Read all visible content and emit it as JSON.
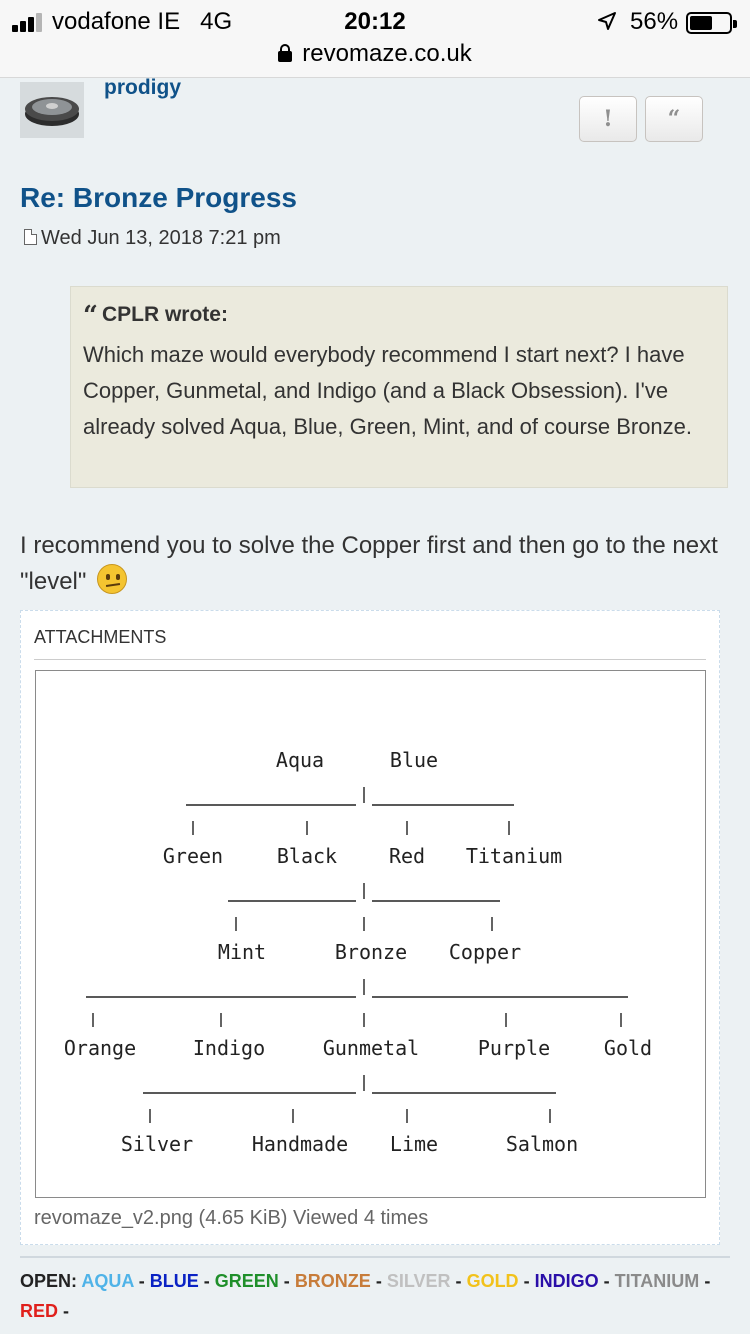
{
  "statusbar": {
    "carrier": "vodafone IE",
    "network": "4G",
    "time": "20:12",
    "battery": "56%",
    "url": "revomaze.co.uk"
  },
  "post": {
    "username": "prodigy",
    "report_icon": "!",
    "quote_icon": "“",
    "title": "Re: Bronze Progress",
    "date": "Wed Jun 13, 2018 7:21 pm",
    "quote": {
      "author": "CPLR wrote:",
      "text": "Which maze would everybody recommend I start next? I have Copper, Gunmetal, and Indigo (and a Black Obsession). I've already solved Aqua, Blue, Green, Mint, and of course Bronze."
    },
    "body": "I recommend you to solve the Copper first and then go to the next \"level\""
  },
  "attachments": {
    "label": "ATTACHMENTS",
    "caption": "revomaze_v2.png (4.65 KiB) Viewed 4 times",
    "tree": {
      "level1": [
        "Aqua",
        "Blue"
      ],
      "level2": [
        "Green",
        "Black",
        "Red",
        "Titanium"
      ],
      "level3": [
        "Mint",
        "Bronze",
        "Copper"
      ],
      "level4": [
        "Orange",
        "Indigo",
        "Gunmetal",
        "Purple",
        "Gold"
      ],
      "level5": [
        "Silver",
        "Handmade",
        "Lime",
        "Salmon"
      ]
    }
  },
  "signature": {
    "prefix": "OPEN:",
    "separator": "-",
    "items": [
      {
        "name": "AQUA",
        "color": "#4fb3e8"
      },
      {
        "name": "BLUE",
        "color": "#0a22c4"
      },
      {
        "name": "GREEN",
        "color": "#1f8f2a"
      },
      {
        "name": "BRONZE",
        "color": "#c77c3a"
      },
      {
        "name": "SILVER",
        "color": "#c0c0c0"
      },
      {
        "name": "GOLD",
        "color": "#f2c21b"
      },
      {
        "name": "INDIGO",
        "color": "#2a0fa8"
      },
      {
        "name": "TITANIUM",
        "color": "#8a8a8a"
      },
      {
        "name": "RED",
        "color": "#e0201c"
      }
    ]
  }
}
